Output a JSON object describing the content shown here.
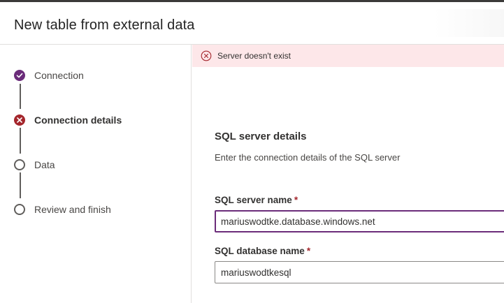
{
  "header": {
    "title": "New table from external data"
  },
  "steps": [
    {
      "label": "Connection",
      "state": "done"
    },
    {
      "label": "Connection details",
      "state": "error"
    },
    {
      "label": "Data",
      "state": "todo"
    },
    {
      "label": "Review and finish",
      "state": "todo"
    }
  ],
  "banner": {
    "message": "Server doesn't exist"
  },
  "form": {
    "section_title": "SQL server details",
    "section_description": "Enter the connection details of the SQL server",
    "server_label": "SQL server name",
    "server_value": "mariuswodtke.database.windows.net",
    "database_label": "SQL database name",
    "database_value": "mariuswodtkesql",
    "required_marker": "*"
  },
  "colors": {
    "accent": "#6b2c7a",
    "error": "#a4262c",
    "error_bg": "#fde7e9"
  }
}
